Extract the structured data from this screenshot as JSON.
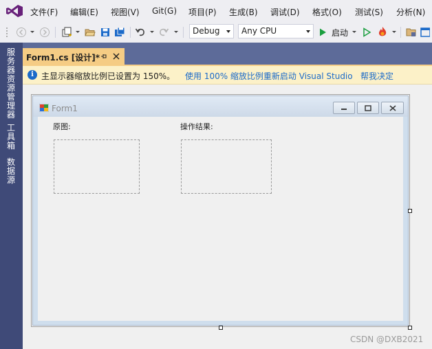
{
  "menu": {
    "items": [
      "文件(F)",
      "编辑(E)",
      "视图(V)",
      "Git(G)",
      "项目(P)",
      "生成(B)",
      "调试(D)",
      "格式(O)",
      "测试(S)",
      "分析(N)"
    ]
  },
  "toolbar": {
    "config": "Debug",
    "platform": "Any CPU",
    "start_label": "启动"
  },
  "side_tabs": [
    "服务器资源管理器",
    "工具箱",
    "数据源"
  ],
  "document_tab": {
    "label": "Form1.cs [设计]*"
  },
  "infobar": {
    "icon_glyph": "i",
    "message": "主显示器缩放比例已设置为 150%。",
    "link_restart": "使用 100% 缩放比例重新启动 Visual Studio",
    "link_decide": "帮我决定"
  },
  "form": {
    "title": "Form1",
    "label_original": "原图:",
    "label_result": "操作结果:"
  },
  "watermark": "CSDN @DXB2021",
  "colors": {
    "menu_bg": "#eeeef2",
    "left_strip": "#3f4a78",
    "tab_strip": "#5d6b99",
    "active_tab": "#f5cc84",
    "info_bg": "#fcf1c8",
    "link": "#1b6ac9",
    "vs_purple": "#68217a",
    "start_green": "#1a9e3f"
  },
  "icons": [
    "visual-studio-logo",
    "back-icon",
    "forward-icon",
    "new-project-icon",
    "open-folder-icon",
    "save-icon",
    "save-all-icon",
    "undo-icon",
    "redo-icon",
    "start-icon",
    "start-without-debug-icon",
    "hot-reload-icon",
    "solution-explorer-icon",
    "info-icon",
    "pin-icon",
    "close-icon",
    "form-icon",
    "minimize-icon",
    "maximize-icon",
    "close-window-icon"
  ]
}
